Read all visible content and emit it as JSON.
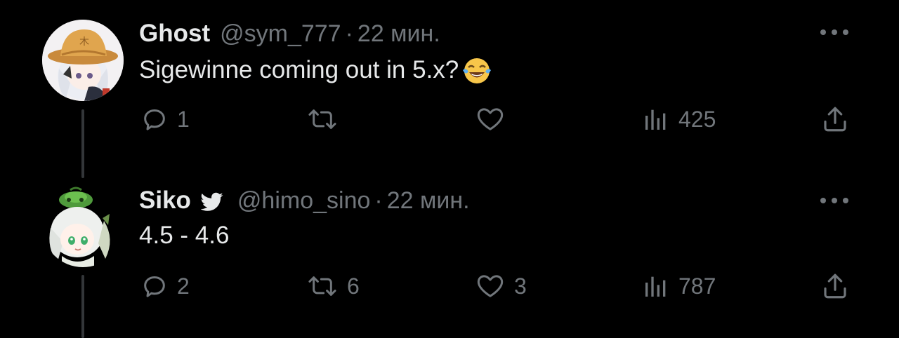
{
  "tweets": [
    {
      "name": "Ghost",
      "handle": "@sym_777",
      "separator": "·",
      "time": "22 мин.",
      "text": "Sigewinne coming out in 5.x?",
      "emoji": "face-with-tears-of-joy",
      "verified": false,
      "replies": "1",
      "retweets": "",
      "likes": "",
      "views": "425"
    },
    {
      "name": "Siko",
      "handle": "@himo_sino",
      "separator": "·",
      "time": "22 мин.",
      "text": "4.5 - 4.6",
      "verified": true,
      "replies": "2",
      "retweets": "6",
      "likes": "3",
      "views": "787"
    }
  ],
  "icons": {
    "reply": "reply-icon",
    "retweet": "retweet-icon",
    "like": "heart-icon",
    "views": "views-icon",
    "share": "share-icon",
    "more": "more-icon",
    "verified": "twitter-bird-icon"
  },
  "colors": {
    "background": "#000000",
    "text_primary": "#e7e9ea",
    "text_secondary": "#71767b",
    "thread_line": "#333639"
  }
}
